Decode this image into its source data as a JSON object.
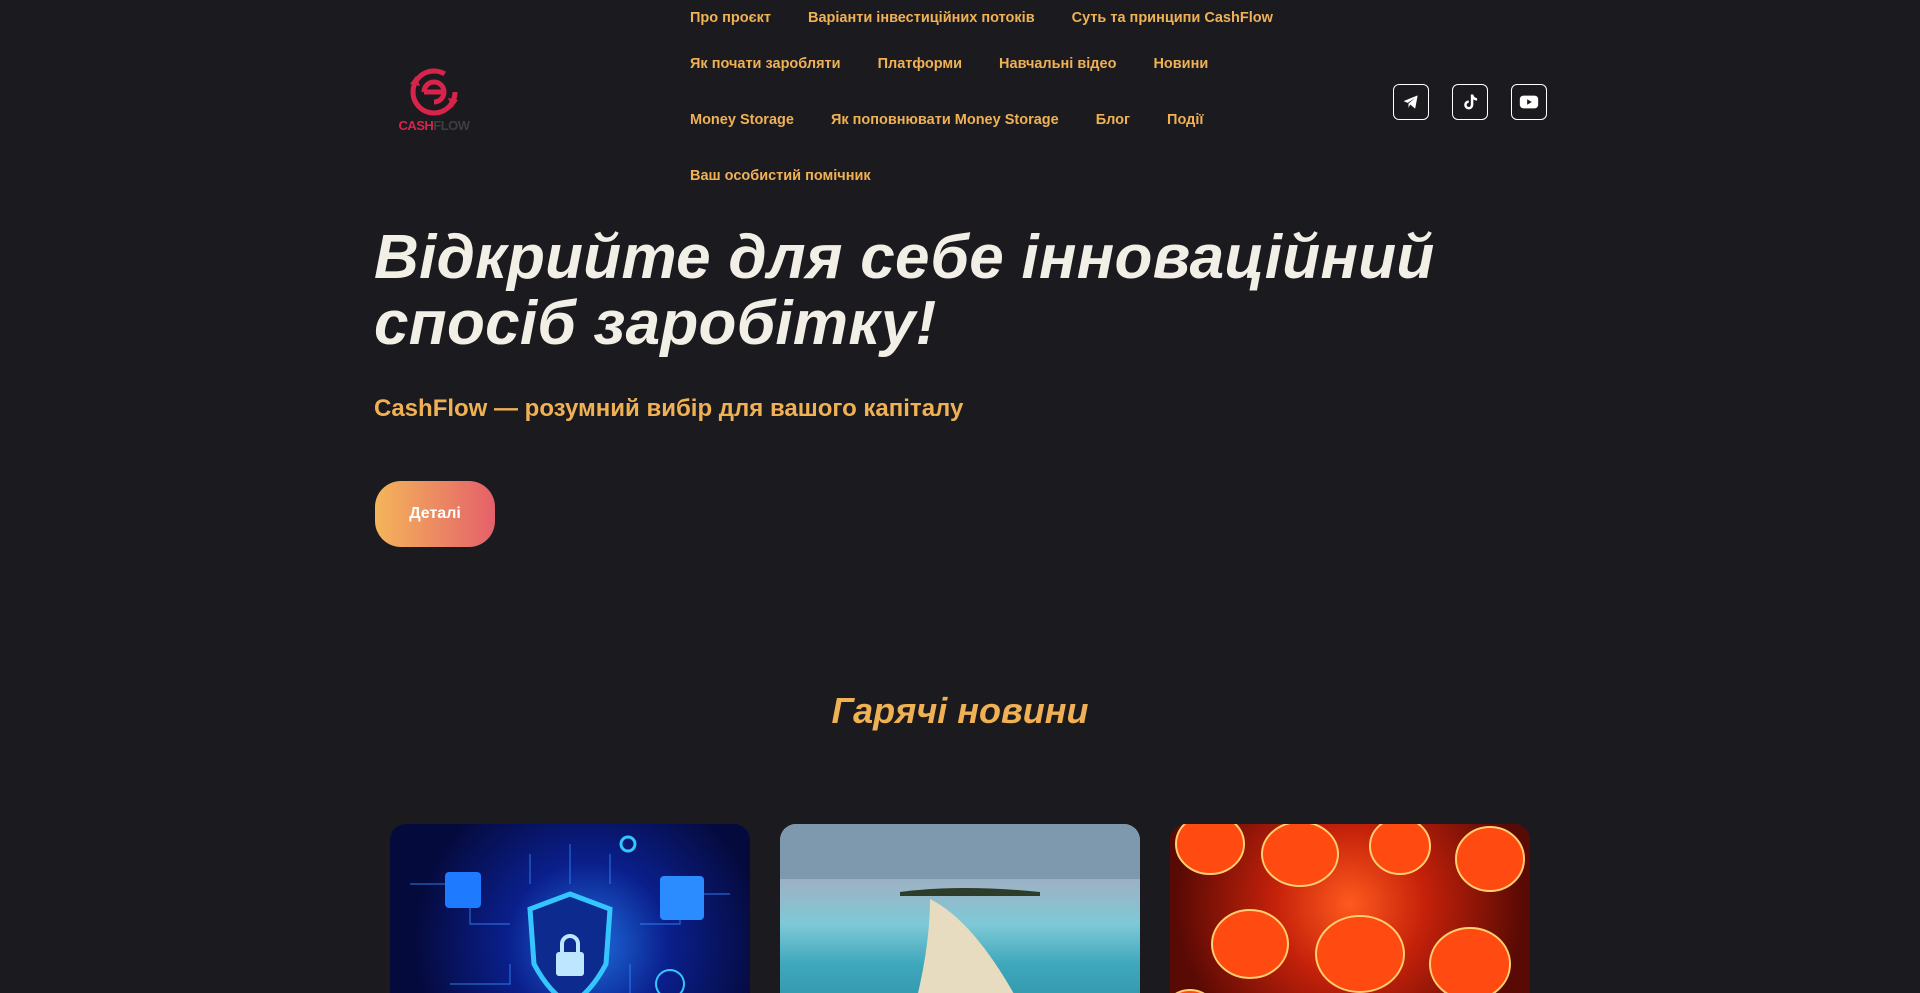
{
  "brand": {
    "logo_text_a": "CASH",
    "logo_text_b": "FLOW",
    "accent": "#d8244a"
  },
  "nav": {
    "rows": [
      [
        "Про проєкт",
        "Варіанти інвестиційних потоків",
        "Суть та принципи CashFlow"
      ],
      [
        "Як почати заробляти",
        "Платформи",
        "Навчальні відео",
        "Новини"
      ],
      [
        "Money Storage",
        "Як поповнювати Money Storage",
        "Блог",
        "Події"
      ],
      [
        "Ваш особистий помічник"
      ]
    ]
  },
  "socials": [
    "telegram-icon",
    "tiktok-icon",
    "youtube-icon"
  ],
  "hero": {
    "title_line1": "Відкрийте для себе інноваційний",
    "title_line2": "спосіб заробітку!",
    "subtitle": "CashFlow — розумний вибір для вашого капіталу",
    "cta_label": "Деталі"
  },
  "news": {
    "title": "Гарячі новини"
  },
  "colors": {
    "background": "#1b1b1f",
    "nav_text": "#f0b155",
    "title_text": "#f2efe6"
  }
}
